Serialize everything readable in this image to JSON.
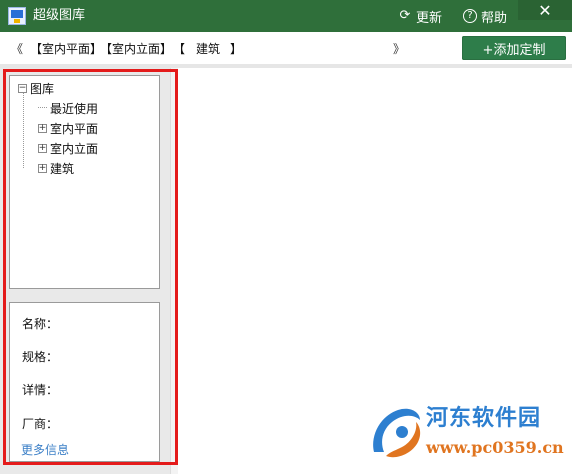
{
  "window": {
    "title": "超级图库",
    "update_label": "更新",
    "help_label": "帮助",
    "close_glyph": "✕"
  },
  "toolbar": {
    "nav_left": "《",
    "nav_right": "》",
    "breadcrumbs": [
      "【室内平面】",
      "【室内立面】",
      "【",
      "建筑",
      "】"
    ],
    "add_label": "+添加定制"
  },
  "tree": {
    "root_label": "图库",
    "items": [
      {
        "label": "最近使用",
        "expandable": false
      },
      {
        "label": "室内平面",
        "expandable": true
      },
      {
        "label": "室内立面",
        "expandable": true
      },
      {
        "label": "建筑",
        "expandable": true
      }
    ]
  },
  "info": {
    "name_label": "名称：",
    "spec_label": "规格：",
    "detail_label": "详情：",
    "vendor_label": "厂商：",
    "more_label": "更多信息"
  },
  "watermark": {
    "line1": "河东软件园",
    "line2": "www.pc0359.cn"
  },
  "colors": {
    "titlebar": "#2f6f3a",
    "add_button": "#2e7d4a",
    "highlight_box": "#e41b1b",
    "link": "#3b7fc7"
  }
}
